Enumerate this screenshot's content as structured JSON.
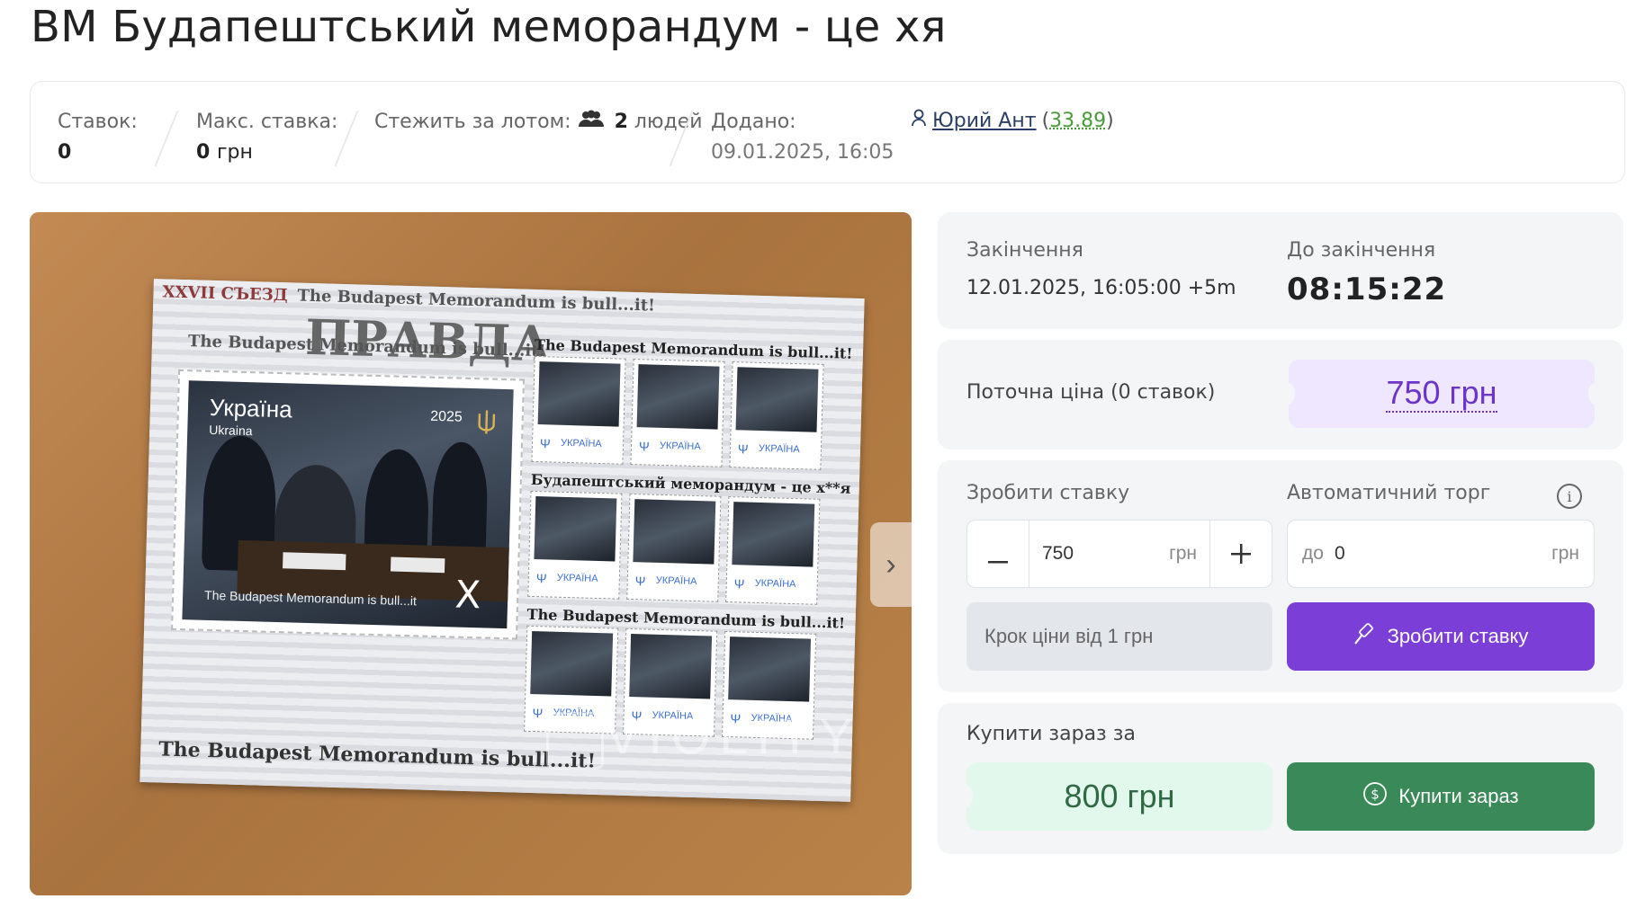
{
  "title": "ВМ Будапештський меморандум - це хя",
  "stats": {
    "bids_label": "Ставок:",
    "bids_value": "0",
    "max_bid_label": "Макс. ставка:",
    "max_bid_value": "0",
    "max_bid_unit": "грн",
    "watch_label": "Стежить за лотом:",
    "watch_count": "2",
    "watch_unit": "людей",
    "added_label": "Додано:",
    "added_value": "09.01.2025, 16:05",
    "seller_name": "Юрий Ант",
    "seller_rating": "33.89"
  },
  "photo": {
    "sheet_lines": [
      "XXVII СЪЕЗД",
      "The Budapest Memorandum is bull...it!",
      "ПРАВДА",
      "The Budapest Memorandum is bull...it!"
    ],
    "stamp_country": "Україна",
    "stamp_country_sub": "Ukraina",
    "stamp_year": "2025",
    "stamp_caption": "The Budapest Memorandum is bull...it",
    "stamp_mark": "X",
    "mini_bands": [
      "The Budapest Memorandum is bull...it!",
      "Будапештський меморандум - це х**я",
      "The Budapest Memorandum is bull...it!"
    ],
    "mini_label": "УКРАЇНА",
    "bottom_line": "The Budapest Memorandum is bull...it!",
    "watermark": "VIOLITY",
    "arrow_glyph": "›"
  },
  "auction": {
    "end_label": "Закінчення",
    "end_value": "12.01.2025, 16:05:00 +5m",
    "remaining_label": "До закінчення",
    "remaining_value": "08:15:22",
    "current_price_label": "Поточна ціна (0 ставок)",
    "current_price": "750 грн",
    "make_bid_label": "Зробити ставку",
    "auto_bid_label": "Автоматичний торг",
    "bid_value": "750",
    "bid_unit": "грн",
    "auto_prefix": "до",
    "auto_value": "0",
    "auto_unit": "грн",
    "step_text": "Крок ціни від 1 грн",
    "bid_button": "Зробити ставку",
    "buy_now_label": "Купити зараз за",
    "buy_now_price": "800 грн",
    "buy_button": "Купити зараз"
  },
  "colors": {
    "accent_purple": "#7b3ed6",
    "accent_green": "#3a8a59",
    "price_purple": "#6b35c9"
  }
}
